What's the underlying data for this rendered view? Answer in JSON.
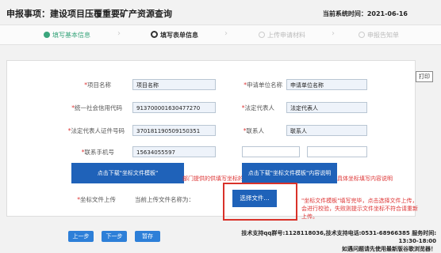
{
  "header": {
    "title": "申报事项：建设项目压覆重要矿产资源查询",
    "system_date_label": "当前系统时间：",
    "system_date": "2021-06-16"
  },
  "steps": [
    {
      "label": "填写基本信息",
      "state": "done"
    },
    {
      "label": "填写表单信息",
      "state": "current"
    },
    {
      "label": "上传申请材料",
      "state": "todo"
    },
    {
      "label": "申报告知单",
      "state": "todo"
    }
  ],
  "print_label": "打印",
  "form": {
    "project_name": {
      "label": "项目名称",
      "value": "项目名称"
    },
    "applicant_name": {
      "label": "申请单位名称",
      "value": "申请单位名称"
    },
    "credit_code": {
      "label": "统一社会信用代码",
      "value": "913700001630477270"
    },
    "legal_rep": {
      "label": "法定代表人",
      "value": "法定代表人"
    },
    "legal_rep_id": {
      "label": "法定代表人证件号码",
      "value": "370181190509150351"
    },
    "contact": {
      "label": "联系人",
      "value": "联系人"
    },
    "contact_phone": {
      "label": "联系手机号",
      "value": "15634055597"
    },
    "extra_field_1": {
      "value": ""
    },
    "extra_field_2": {
      "value": ""
    }
  },
  "download_template_btn": "点击下载\"坐标文件模板\"",
  "download_content_btn": "点击下载\"坐标文件模板\"内容说明",
  "note_left": "部门提供的供填写坐标的模板",
  "note_right": "具体坐标填写内容说明",
  "upload": {
    "label": "坐标文件上传",
    "current_file_label": "当前上传文件名称为：",
    "choose_btn": "选择文件..."
  },
  "upload_note": "\"坐标文件模板\"填写完毕，点击选择文件上传，会进行校验，失败则提示文件坐标不符合请重新上传。",
  "nav": {
    "prev": "上一步",
    "next": "下一步",
    "save": "暂存"
  },
  "footer": {
    "line1": "技术支持qq群号:1128118036,技术支持电话:0531-68966385 服务时间:",
    "line2": "13:30-18:00",
    "line3": "如遇问题请先使用最新版谷歌浏览器！"
  }
}
